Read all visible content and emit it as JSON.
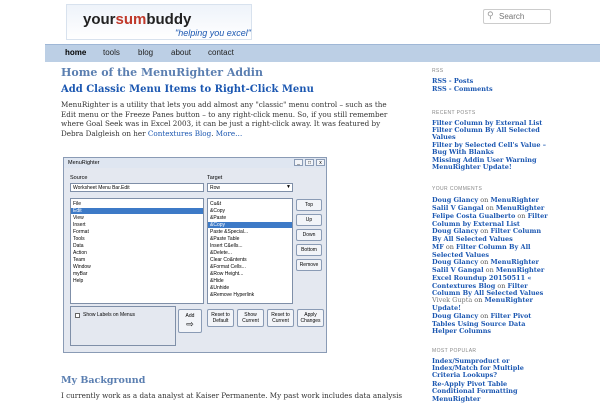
{
  "header": {
    "logo_part1": "your",
    "logo_part2": "sum",
    "logo_part3": "buddy",
    "tagline": "\"helping you excel\"",
    "search_placeholder": "Search"
  },
  "nav": {
    "items": [
      {
        "label": "home"
      },
      {
        "label": "tools"
      },
      {
        "label": "blog"
      },
      {
        "label": "about"
      },
      {
        "label": "contact"
      }
    ]
  },
  "main": {
    "page_title": "Home of the MenuRighter Addin",
    "post_title": "Add Classic Menu Items to Right-Click Menu",
    "intro_text": "MenuRighter is a utility that lets you add almost any \"classic\" menu control – such as the Edit menu or the Freeze Panes button – to any right-click menu.  So, if you still remember where Goal Seek was in Excel 2003, it can be just a right-click away.  It was featured by Debra Dalgleish on her ",
    "intro_link": "Contextures Blog",
    "intro_after": ".  ",
    "more_link": "More…",
    "background_title": "My Background",
    "background_text": "I currently work as a data analyst at Kaiser Permanente. My past work includes data analysis"
  },
  "dialog": {
    "title": "MenuRighter",
    "source_label": "Source",
    "source_value": "Worksheet Menu Bar.Edit",
    "target_label": "Target",
    "target_value": "Row",
    "source_items": [
      "File",
      "Edit",
      "View",
      "Insert",
      "Format",
      "Tools",
      "Data",
      "Action",
      "Team",
      "Window",
      "myBar",
      "Help"
    ],
    "target_items": [
      "Cu&t",
      "&Copy",
      "&Paste",
      "&Copy",
      "Paste &Special...",
      "&Paste Table",
      "Insert C&ells...",
      "&Delete...",
      "Clear Co&ntents",
      "&Format Cells...",
      "&Row Height...",
      "&Hide",
      "&Unhide",
      "&Remove Hyperlink"
    ],
    "btn_top": "Top",
    "btn_up": "Up",
    "btn_down": "Down",
    "btn_bottom": "Bottom",
    "btn_remove": "Remove",
    "checkbox_label": "Show Labels on Menus",
    "btn_add": "Add",
    "btn_reset_default": "Reset to Default",
    "btn_show_current": "Show Current",
    "btn_reset_current": "Reset to Current",
    "btn_apply": "Apply Changes"
  },
  "sidebar": {
    "rss_heading": "RSS",
    "rss_posts": "RSS - Posts",
    "rss_comments": "RSS - Comments",
    "recent_heading": "RECENT POSTS",
    "recent_posts": [
      "Filter Column by External List",
      "Filter Column By All Selected Values",
      "Filter by Selected Cell's Value – Bug With Blanks",
      "Missing Addin User Warning",
      "MenuRighter Update!"
    ],
    "comments_heading": "YOUR COMMENTS",
    "comments": [
      {
        "author": "Doug Glancy",
        "on": "on",
        "post": "MenuRighter"
      },
      {
        "author": "Salil V Gangal",
        "on": "on",
        "post": "MenuRighter"
      },
      {
        "author": "Felipe Costa Gualberto",
        "on": "on",
        "post": "Filter Column by External List"
      },
      {
        "author": "Doug Glancy",
        "on": "on",
        "post": "Filter Column By All Selected Values"
      },
      {
        "author": "MF",
        "on": "on",
        "post": "Filter Column By All Selected Values"
      },
      {
        "author": "Doug Glancy",
        "on": "on",
        "post": "MenuRighter"
      },
      {
        "author": "Salil V Gangal",
        "on": "on",
        "post": "MenuRighter"
      },
      {
        "author": "Excel Roundup 20150511 « Contextures Blog",
        "on": "on",
        "post": "Filter Column By All Selected Values"
      },
      {
        "author": "Vivek Gupta",
        "on": "on",
        "post": "MenuRighter Update!"
      },
      {
        "author": "Doug Glancy",
        "on": "on",
        "post": "Filter Pivot Tables Using Source Data Helper Columns"
      }
    ],
    "popular_heading": "MOST POPULAR",
    "popular": [
      "Index/Sumproduct or Index/Match for Multiple Criteria Lookups?",
      "Re-Apply Pivot Table Conditional Formatting",
      "MenuRighter"
    ]
  }
}
